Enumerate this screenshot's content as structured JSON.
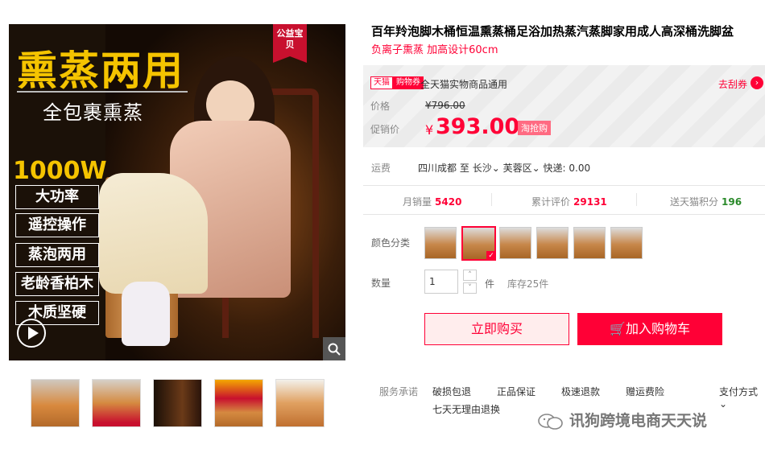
{
  "product": {
    "title": "百年羚泡脚木桶恒温熏蒸桶足浴加热蒸汽蒸脚家用成人高深桶洗脚盆",
    "subtitle": "负离子熏蒸 加高设计60cm"
  },
  "main_image": {
    "badge": "公益宝贝",
    "headline": "熏蒸两用",
    "subhead": "全包裹熏蒸",
    "power": "1000W",
    "features": [
      "大功率",
      "遥控操作",
      "蒸泡两用",
      "老龄香柏木",
      "木质坚硬"
    ]
  },
  "coupon": {
    "tag_a": "天猫",
    "tag_b": "购物券",
    "text": "全天猫实物商品通用",
    "link": "去刮券",
    "arrow": "›"
  },
  "price": {
    "orig_label": "价格",
    "orig_value": "¥796.00",
    "cur_label": "促销价",
    "currency": "¥",
    "cur_value": "393.00",
    "promo_tag": "淘抢购"
  },
  "shipping": {
    "label": "运费",
    "from": "四川成都",
    "to_prefix": "至",
    "city": "长沙",
    "district": "芙蓉区",
    "fee": "快递: 0.00"
  },
  "stats": {
    "monthly_label": "月销量",
    "monthly_value": "5420",
    "reviews_label": "累计评价",
    "reviews_value": "29131",
    "points_label": "送天猫积分",
    "points_value": "196"
  },
  "sku": {
    "label": "颜色分类",
    "count": 6,
    "selected_index": 1
  },
  "quantity": {
    "label": "数量",
    "value": "1",
    "unit": "件",
    "stock": "库存25件",
    "up": "˄",
    "down": "˅"
  },
  "actions": {
    "buy": "立即购买",
    "cart": "加入购物车"
  },
  "service": {
    "label": "服务承诺",
    "items": [
      "破损包退",
      "正品保证",
      "极速退款",
      "赠运费险",
      "七天无理由退换"
    ],
    "payment": "支付方式"
  },
  "watermark": "讯狗跨境电商天天说",
  "colors": {
    "accent": "#ff0036",
    "points": "#2a8a2a"
  }
}
